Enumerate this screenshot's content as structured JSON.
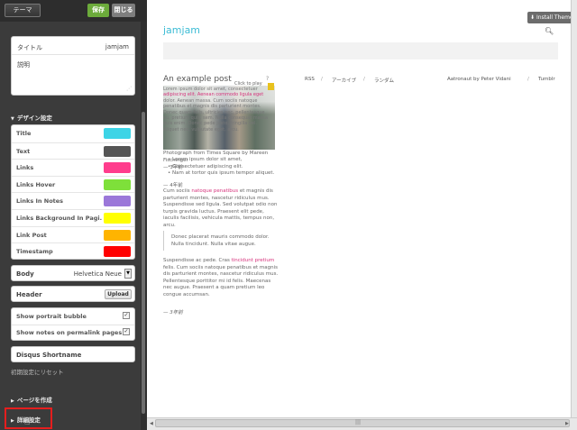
{
  "toolbar": {
    "theme_label": "テーマ",
    "save_label": "保存",
    "close_label": "閉じる"
  },
  "title_card": {
    "title_label": "タイトル",
    "title_value": "jamjam",
    "desc_label": "説明"
  },
  "design_section": {
    "label": "デザイン設定"
  },
  "colors": [
    {
      "label": "Title",
      "color": "#3dd4e6"
    },
    {
      "label": "Text",
      "color": "#555555"
    },
    {
      "label": "Links",
      "color": "#ff3d8d"
    },
    {
      "label": "Links Hover",
      "color": "#7ee03a"
    },
    {
      "label": "Links In Notes",
      "color": "#9b77d9"
    },
    {
      "label": "Links Background In Pagi...",
      "color": "#ffff00"
    },
    {
      "label": "Link Post",
      "color": "#ffb400"
    },
    {
      "label": "Timestamp",
      "color": "#ff0000"
    }
  ],
  "body_font": {
    "label": "Body",
    "value": "Helvetica Neue"
  },
  "header": {
    "label": "Header",
    "upload_label": "Upload"
  },
  "options": [
    {
      "label": "Show portrait bubble",
      "checked": "✓"
    },
    {
      "label": "Show notes on permalink pages",
      "checked": "✓"
    }
  ],
  "disqus": {
    "label": "Disqus Shortname"
  },
  "reset_label": "初期設定にリセット",
  "pages_section": {
    "label": "ページを作成"
  },
  "advanced_section": {
    "label": "詳細設定"
  },
  "preview": {
    "install_label": "Install Theme",
    "blog_title": "jamjam",
    "post_title": "An example post",
    "nav": {
      "rss": "RSS",
      "archive": "アーカイブ",
      "random": "ランダム"
    },
    "credit": {
      "author": "Aatronaut by Peter Vidani",
      "tumblr": "Tumblr"
    },
    "click_to_play": "Click to play",
    "qmark": "?",
    "photo_lines": [
      "Lorem ipsum dolor sit amet, consectetuer",
      "adipiscing elit. Aenean commodo ligula eget",
      "dolor. Aenean massa. Cum sociis natoque",
      "penatibus et magnis dis parturient montes.",
      "Donec quam felis, ultricies nec, pellentesque",
      "eu, pretium quis, sem. Nulla consequat massa",
      "quis enim. Donec pede justo, fringilla vel.",
      "Aliquet nec, vulputate eget, arcu."
    ],
    "caption": "Photograph from Times Square by Mareen Fischinger",
    "caption_link": "Mareen Fischinger",
    "tag1": "— 3年前",
    "bullets": [
      "Lorem ipsum dolor sit amet,",
      "Consectetuer adipiscing elit.",
      "Nam at tortor quis ipsum tempor aliquet."
    ],
    "tag2": "— 4年前",
    "para1_a": "Cum sociis ",
    "para1_link": "natoque penatibus",
    "para1_b": " et magnis dis parturient montes, nascetur ridiculus mus. Suspendisse sed ligula. Sed volutpat odio non turpis gravida luctus. Praesent elit pede, iaculis facilisis, vehicula mattis, tempus non, arcu.",
    "quote": "Donec placerat mauris commodo dolor. Nulla tincidunt. Nulla vitae augue.",
    "para2_a": "Suspendisse ac pede. Cras ",
    "para2_link": "tincidunt pretium",
    "para2_b": " felis. Cum sociis natoque penatibus et magnis dis parturient montes, nascetur ridiculus mus. Pellentesque porttitor mi id felis. Maecenas nec augue. Praesent a quam pretium leo congue accumsan.",
    "tag3": "— 3年前",
    "h_grip": "|||"
  }
}
